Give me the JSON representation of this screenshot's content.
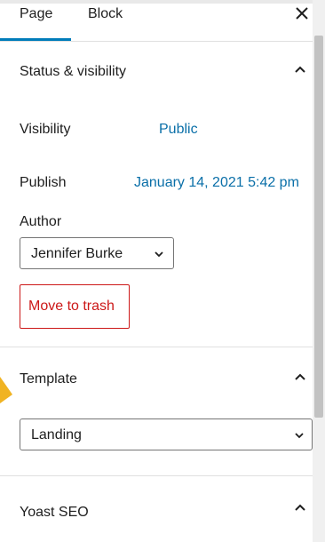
{
  "tabs": {
    "page_label": "Page",
    "block_label": "Block"
  },
  "status_panel": {
    "title": "Status & visibility",
    "visibility_label": "Visibility",
    "visibility_value": "Public",
    "publish_label": "Publish",
    "publish_value": "January 14, 2021 5:42 pm",
    "author_label": "Author",
    "author_value": "Jennifer Burke",
    "trash_label": "Move to trash"
  },
  "template_panel": {
    "title": "Template",
    "selected": "Landing"
  },
  "yoast_panel": {
    "title": "Yoast SEO"
  },
  "colors": {
    "accent": "#007cba",
    "link": "#0a6fa8",
    "danger": "#cc1818",
    "pointer": "#f0b323"
  }
}
